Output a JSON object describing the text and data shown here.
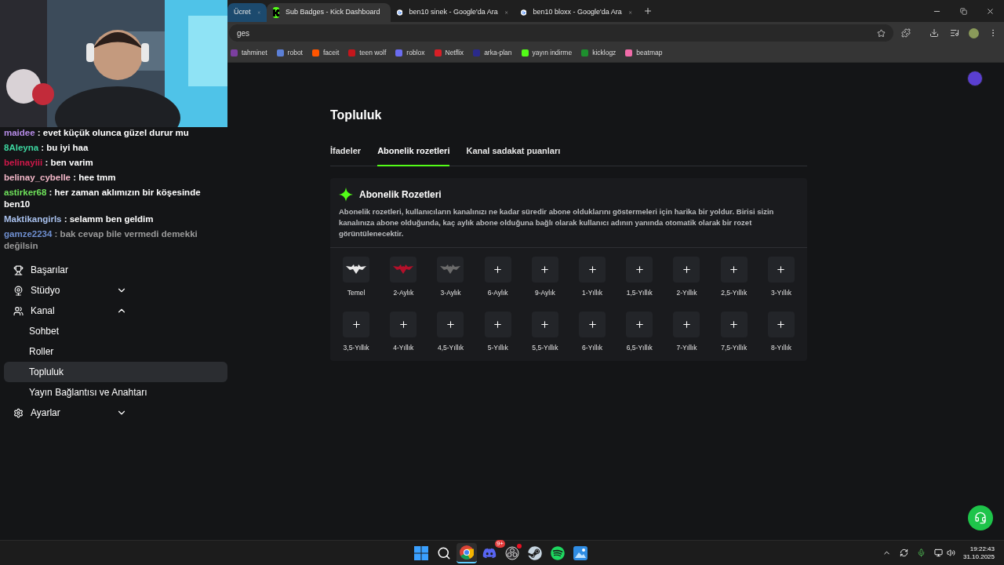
{
  "browser": {
    "tabs": [
      {
        "title": "Ücret",
        "kind": "group",
        "selected": false
      },
      {
        "title": "Sub Badges - Kick Dashboard",
        "kind": "kick",
        "selected": true
      },
      {
        "title": "ben10 sinek - Google'da Ara",
        "kind": "google",
        "selected": false
      },
      {
        "title": "ben10 bloxx - Google'da Ara",
        "kind": "google",
        "selected": false
      }
    ],
    "address": "ges",
    "bookmarks": [
      {
        "label": "tahminet",
        "color": "#7b3fa0"
      },
      {
        "label": "robot",
        "color": "#5b7fd6"
      },
      {
        "label": "faceit",
        "color": "#ff5500"
      },
      {
        "label": "teen wolf",
        "color": "#c4161c"
      },
      {
        "label": "roblox",
        "color": "#6a6cf0"
      },
      {
        "label": "Netflix",
        "color": "#d81f26"
      },
      {
        "label": "arka-plan",
        "color": "#2a2a8a"
      },
      {
        "label": "yayın indirme",
        "color": "#53fc18"
      },
      {
        "label": "kicklogz",
        "color": "#1e8f2e"
      },
      {
        "label": "beatmap",
        "color": "#f06ba8"
      }
    ]
  },
  "chat_overlay": {
    "messages": [
      {
        "user": "maidee",
        "color": "#b58be6",
        "text": ": evet küçük olunca güzel durur mu",
        "faded": false
      },
      {
        "user": "8Aleyna",
        "color": "#3dd6a0",
        "text": ": bu iyi haa",
        "faded": false
      },
      {
        "user": "belinayiii",
        "color": "#d0184a",
        "text": ": ben varim",
        "faded": false
      },
      {
        "user": "belinay_cybelle",
        "color": "#f3b7c8",
        "text": ": hee tmm",
        "faded": false
      },
      {
        "user": "astirker68",
        "color": "#6ee05a",
        "text": ": her zaman aklımızın bir köşesinde ben10",
        "faded": false
      },
      {
        "user": "Maktikangirls",
        "color": "#a9c1ee",
        "text": ": selamm ben geldim",
        "faded": false
      },
      {
        "user": "gamze2234",
        "color": "#6f8fd0",
        "text": ": bak cevap bile vermedi demekki değilsin",
        "faded": true
      }
    ]
  },
  "sidebar": {
    "items": [
      {
        "label": "Başarılar",
        "kind": "trophy",
        "selected": false
      },
      {
        "label": "Stüdyo",
        "kind": "camera",
        "selected": false,
        "expanded": false
      },
      {
        "label": "Kanal",
        "kind": "users",
        "selected": false,
        "expanded": true,
        "children": [
          {
            "label": "Sohbet",
            "selected": false
          },
          {
            "label": "Roller",
            "selected": false
          },
          {
            "label": "Topluluk",
            "selected": true
          },
          {
            "label": "Yayın Bağlantısı ve Anahtarı",
            "selected": false
          }
        ]
      },
      {
        "label": "Ayarlar",
        "kind": "gear",
        "selected": false,
        "expanded": false
      }
    ]
  },
  "page": {
    "title": "Topluluk",
    "tabs": [
      {
        "label": "İfadeler",
        "selected": false
      },
      {
        "label": "Abonelik rozetleri",
        "selected": true
      },
      {
        "label": "Kanal sadakat puanları",
        "selected": false
      }
    ],
    "card": {
      "title": "Abonelik Rozetleri",
      "description": "Abonelik rozetleri, kullanıcıların kanalınızı ne kadar süredir abone olduklarını göstermeleri için harika bir yoldur. Birisi sizin kanalınıza abone olduğunda, kaç aylık abone olduğuna bağlı olarak kullanıcı adının yanında otomatik olarak bir rozet görüntülenecektir.",
      "badges": [
        {
          "label": "Temel",
          "kind": "bat",
          "color": "#e8e8e8"
        },
        {
          "label": "2-Aylık",
          "kind": "bat",
          "color": "#b3102a"
        },
        {
          "label": "3-Aylık",
          "kind": "bat",
          "color": "#6b6b6b"
        },
        {
          "label": "6-Aylık",
          "kind": "add"
        },
        {
          "label": "9-Aylık",
          "kind": "add"
        },
        {
          "label": "1-Yıllık",
          "kind": "add"
        },
        {
          "label": "1,5-Yıllık",
          "kind": "add"
        },
        {
          "label": "2-Yıllık",
          "kind": "add"
        },
        {
          "label": "2,5-Yıllık",
          "kind": "add"
        },
        {
          "label": "3-Yıllık",
          "kind": "add"
        },
        {
          "label": "3,5-Yıllık",
          "kind": "add"
        },
        {
          "label": "4-Yıllık",
          "kind": "add"
        },
        {
          "label": "4,5-Yıllık",
          "kind": "add"
        },
        {
          "label": "5-Yıllık",
          "kind": "add"
        },
        {
          "label": "5,5-Yıllık",
          "kind": "add"
        },
        {
          "label": "6-Yıllık",
          "kind": "add"
        },
        {
          "label": "6,5-Yıllık",
          "kind": "add"
        },
        {
          "label": "7-Yıllık",
          "kind": "add"
        },
        {
          "label": "7,5-Yıllık",
          "kind": "add"
        },
        {
          "label": "8-Yıllık",
          "kind": "add"
        }
      ]
    }
  },
  "taskbar": {
    "apps": [
      {
        "kind": "windows",
        "selected": false
      },
      {
        "kind": "search",
        "selected": false
      },
      {
        "kind": "chrome",
        "selected": true
      },
      {
        "kind": "discord",
        "selected": false,
        "badge": "9+"
      },
      {
        "kind": "obs",
        "selected": false,
        "alert": true
      },
      {
        "kind": "steam",
        "selected": false
      },
      {
        "kind": "spotify",
        "selected": false
      },
      {
        "kind": "photos",
        "selected": false
      }
    ],
    "time": "19:22:43",
    "date": "31.10.2025"
  }
}
